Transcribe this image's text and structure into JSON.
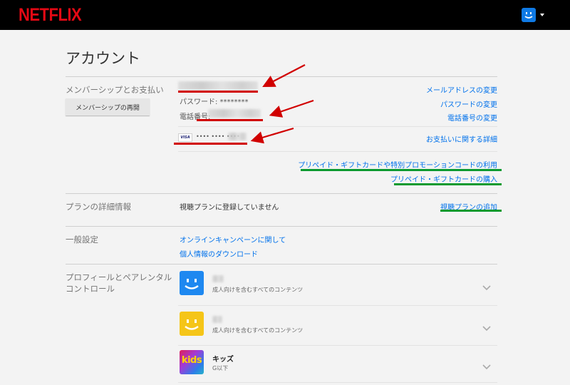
{
  "header": {
    "logo": "NETFLIX"
  },
  "page": {
    "title": "アカウント"
  },
  "membership": {
    "label": "メンバーシップとお支払い",
    "resume_button": "メンバーシップの再開",
    "password_text": "パスワード: ********",
    "phone_label": "電話番号:",
    "card_brand": "VISA",
    "card_number": "•••• •••• ••••",
    "links": {
      "change_email": "メールアドレスの変更",
      "change_password": "パスワードの変更",
      "change_phone": "電話番号の変更",
      "billing_details": "お支払いに関する詳細",
      "redeem_gift": "プリペイド・ギフトカードや特別プロモーションコードの利用",
      "buy_gift": "プリペイド・ギフトカードの購入"
    }
  },
  "plan": {
    "label": "プランの詳細情報",
    "status": "視聴プランに登録していません",
    "add_link": "視聴プランの追加"
  },
  "settings": {
    "label": "一般設定",
    "links": [
      "オンラインキャンペーンに関して",
      "個人情報のダウンロード"
    ]
  },
  "profiles": {
    "label_line1": "プロフィールとペアレンタル",
    "label_line2": "コントロール",
    "items": [
      {
        "name": "",
        "desc": "成人向けを含むすべてのコンテンツ",
        "color": "#1e88f0"
      },
      {
        "name": "",
        "desc": "成人向けを含むすべてのコンテンツ",
        "color": "#f5c518"
      },
      {
        "name": "キッズ",
        "desc": "G以下",
        "icon_text": "kids"
      }
    ]
  },
  "colors": {
    "link": "#0071eb",
    "brand": "#e50914",
    "annotation_red": "#d10000",
    "annotation_green": "#0b9a2f"
  }
}
